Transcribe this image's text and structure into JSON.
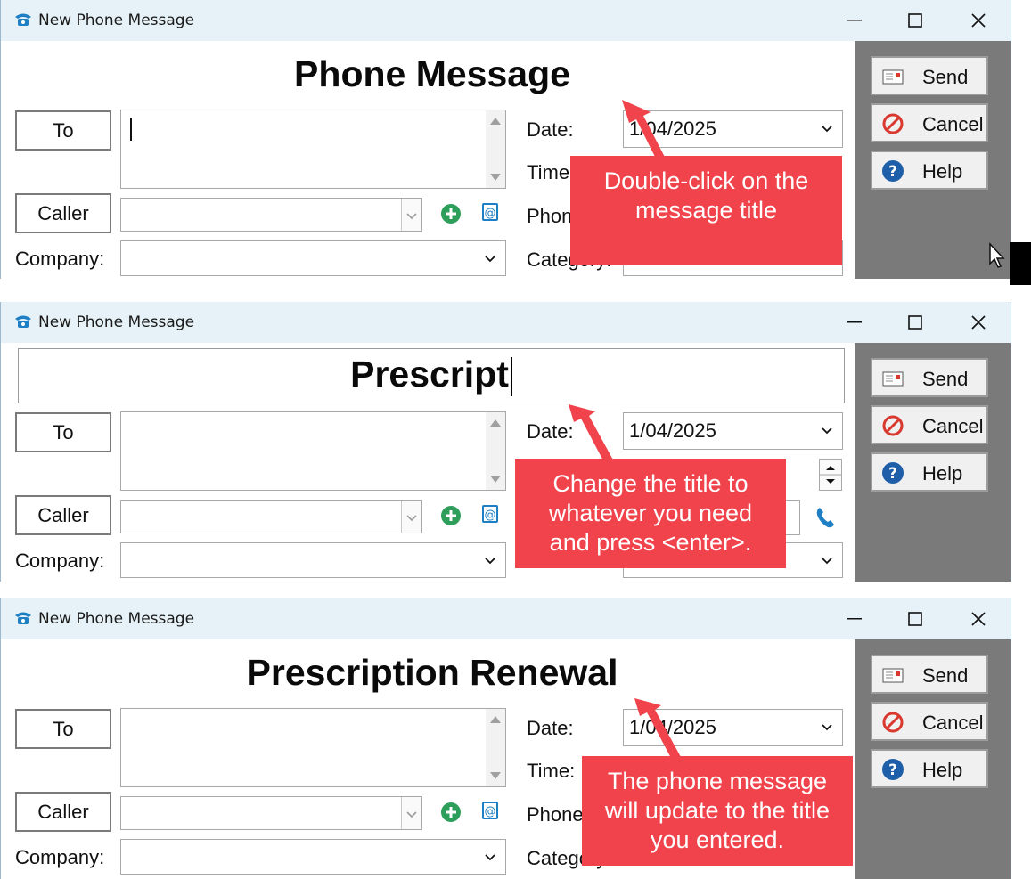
{
  "window": {
    "title": "New Phone Message",
    "minimize_glyph": "—",
    "close_glyph": "✕"
  },
  "fields": {
    "to_label": "To",
    "caller_label": "Caller",
    "company_label": "Company:",
    "date_label": "Date:",
    "time_label": "Time:",
    "phone_label": "Phone",
    "category_label": "Category:",
    "date_value": "1/04/2025"
  },
  "actions": {
    "send": "Send",
    "cancel": "Cancel",
    "help": "Help"
  },
  "panels": [
    {
      "heading": "Phone Message",
      "mode": "display",
      "callout": "Double-click on the message title"
    },
    {
      "heading": "Prescript",
      "mode": "editing",
      "callout": "Change the title to whatever you need and press <enter>."
    },
    {
      "heading": "Prescription Renewal",
      "mode": "display",
      "callout": "The phone message will update to the title you entered."
    }
  ],
  "colors": {
    "titlebar": "#e6f2f7",
    "callout": "#f0434b",
    "side_panel": "#7a7a7a",
    "add_icon": "#2e9e5b",
    "help_icon": "#1f5ea8",
    "cancel_icon": "#d9382f",
    "phone_icon": "#1f7fc4"
  }
}
